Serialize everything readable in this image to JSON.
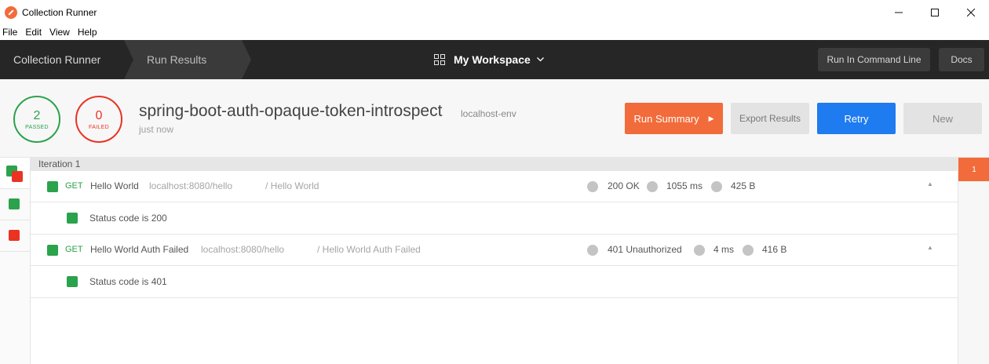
{
  "window": {
    "title": "Collection Runner",
    "controls": [
      "minimize-icon",
      "maximize-icon",
      "close-icon"
    ]
  },
  "menu": [
    "File",
    "Edit",
    "View",
    "Help"
  ],
  "header": {
    "breadcrumbs": [
      "Collection Runner",
      "Run Results"
    ],
    "workspace": "My Workspace",
    "buttons": {
      "command_line": "Run In Command Line",
      "docs": "Docs"
    }
  },
  "summary": {
    "passed": {
      "count": "2",
      "label": "PASSED",
      "color": "#2ba24c"
    },
    "failed": {
      "count": "0",
      "label": "FAILED",
      "color": "#ea3323"
    },
    "collection_name": "spring-boot-auth-opaque-token-introspect",
    "environment": "localhost-env",
    "time": "just now",
    "buttons": {
      "run_summary": "Run Summary",
      "export": "Export Results",
      "retry": "Retry",
      "new": "New"
    },
    "accent_color": "#f26b3a",
    "retry_color": "#1e7bf0"
  },
  "iteration": {
    "label": "Iteration 1",
    "tab_number": "1",
    "requests": [
      {
        "method": "GET",
        "name": "Hello World",
        "url": "localhost:8080/hello",
        "path": "/ Hello World",
        "status": "200 OK",
        "time": "1055 ms",
        "size": "425 B",
        "tests": [
          {
            "name": "Status code is 200",
            "passed": true
          }
        ]
      },
      {
        "method": "GET",
        "name": "Hello World Auth Failed",
        "url": "localhost:8080/hello",
        "path": "/ Hello World Auth Failed",
        "status": "401 Unauthorized",
        "time": "4 ms",
        "size": "416 B",
        "tests": [
          {
            "name": "Status code is 401",
            "passed": true
          }
        ]
      }
    ]
  }
}
